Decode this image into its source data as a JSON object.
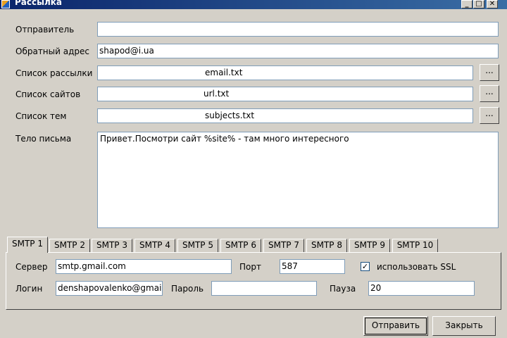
{
  "window": {
    "title": "Рассылка",
    "minimize_glyph": "_",
    "maximize_glyph": "□",
    "close_glyph": "✕"
  },
  "form": {
    "sender": {
      "label": "Отправитель",
      "value": ""
    },
    "reply_to": {
      "label": "Обратный адрес",
      "value": "shapod@i.ua"
    },
    "mailing_list": {
      "label": "Список рассылки",
      "value": "email.txt",
      "browse_label": "..."
    },
    "sites_list": {
      "label": "Список сайтов",
      "value": "url.txt",
      "browse_label": "..."
    },
    "topics_list": {
      "label": "Список тем",
      "value": "subjects.txt",
      "browse_label": "..."
    },
    "body": {
      "label": "Тело письма",
      "value": "Привет.Посмотри сайт %site% - там много интересного"
    }
  },
  "smtp": {
    "tabs": [
      "SMTP 1",
      "SMTP 2",
      "SMTP 3",
      "SMTP 4",
      "SMTP 5",
      "SMTP 6",
      "SMTP 7",
      "SMTP 8",
      "SMTP 9",
      "SMTP 10"
    ],
    "active_tab": "SMTP 1",
    "server_label": "Сервер",
    "server_value": "smtp.gmail.com",
    "port_label": "Порт",
    "port_value": "587",
    "ssl_label": "использовать SSL",
    "ssl_checked": true,
    "login_label": "Логин",
    "login_value": "denshapovalenko@gmail",
    "password_label": "Пароль",
    "password_value": "",
    "pause_label": "Пауза",
    "pause_value": "20"
  },
  "actions": {
    "send_label": "Отправить",
    "close_label": "Закрыть"
  }
}
